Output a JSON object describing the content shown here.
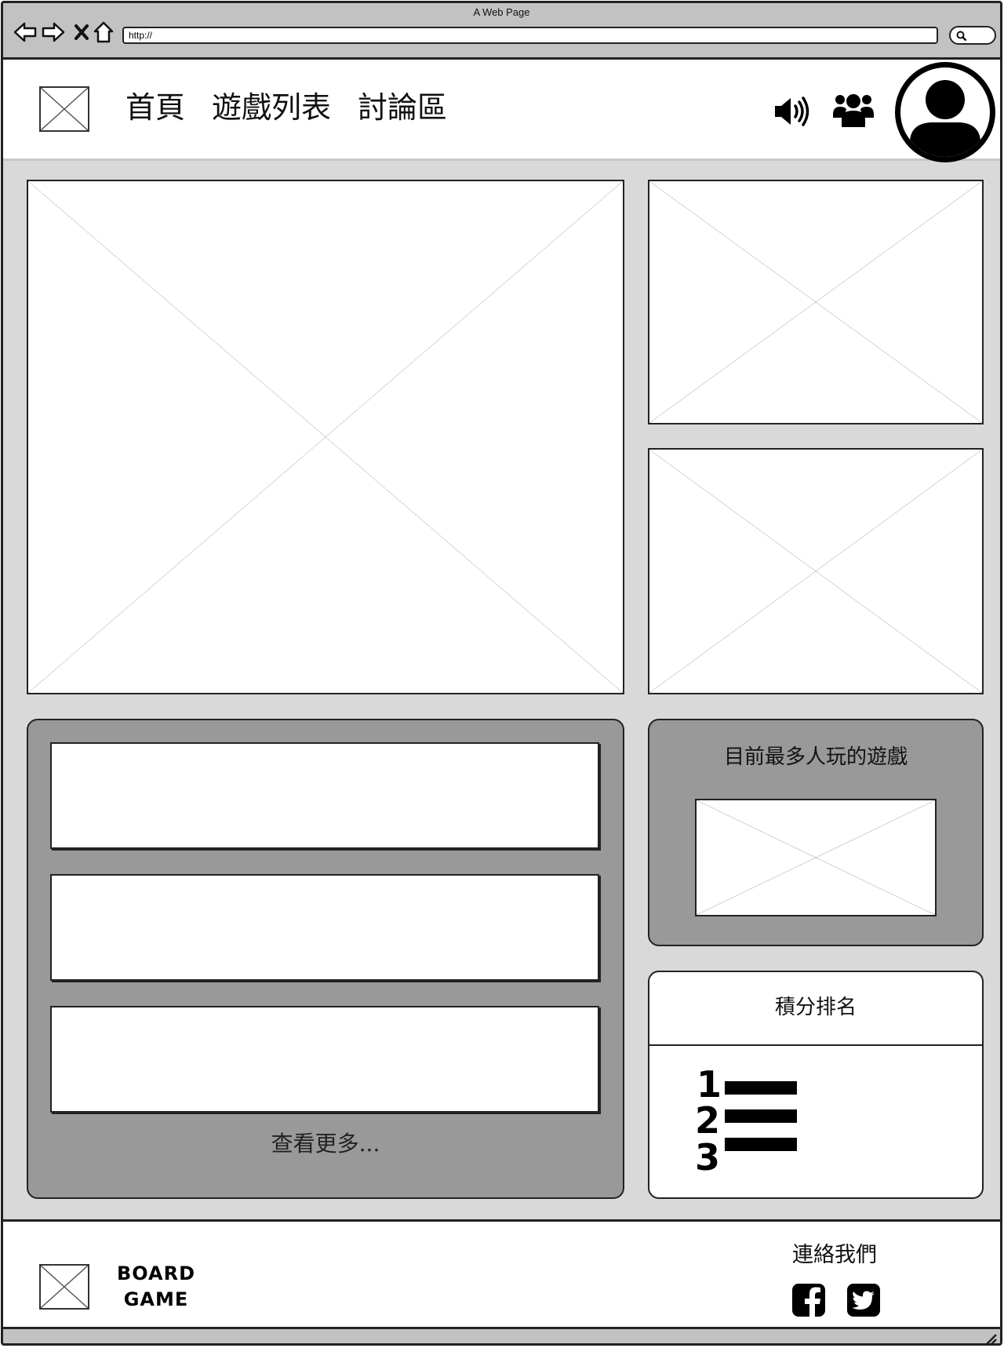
{
  "browser": {
    "window_title": "A Web Page",
    "url": "http://"
  },
  "header": {
    "nav": [
      "首頁",
      "遊戲列表",
      "討論區"
    ]
  },
  "icons": {
    "back": "arrow-left-icon",
    "forward": "arrow-right-icon",
    "stop": "close-icon",
    "home": "home-icon",
    "search": "search-icon",
    "volume": "volume-icon",
    "friends": "users-icon",
    "avatar": "user-avatar-icon",
    "facebook": "facebook-icon",
    "twitter": "twitter-icon",
    "ranking": "ranked-list-icon"
  },
  "news": {
    "more_label": "查看更多..."
  },
  "popular": {
    "title": "目前最多人玩的遊戲"
  },
  "ranking": {
    "title": "積分排名",
    "numbers": [
      "1",
      "2",
      "3"
    ]
  },
  "footer": {
    "brand_line1": "BOARD",
    "brand_line2": "GAME",
    "contact_label": "連絡我們"
  },
  "colors": {
    "page_bg": "#d9d9d9",
    "panel_dark": "#999999",
    "chrome": "#c2c2c2",
    "stroke": "#222222"
  }
}
